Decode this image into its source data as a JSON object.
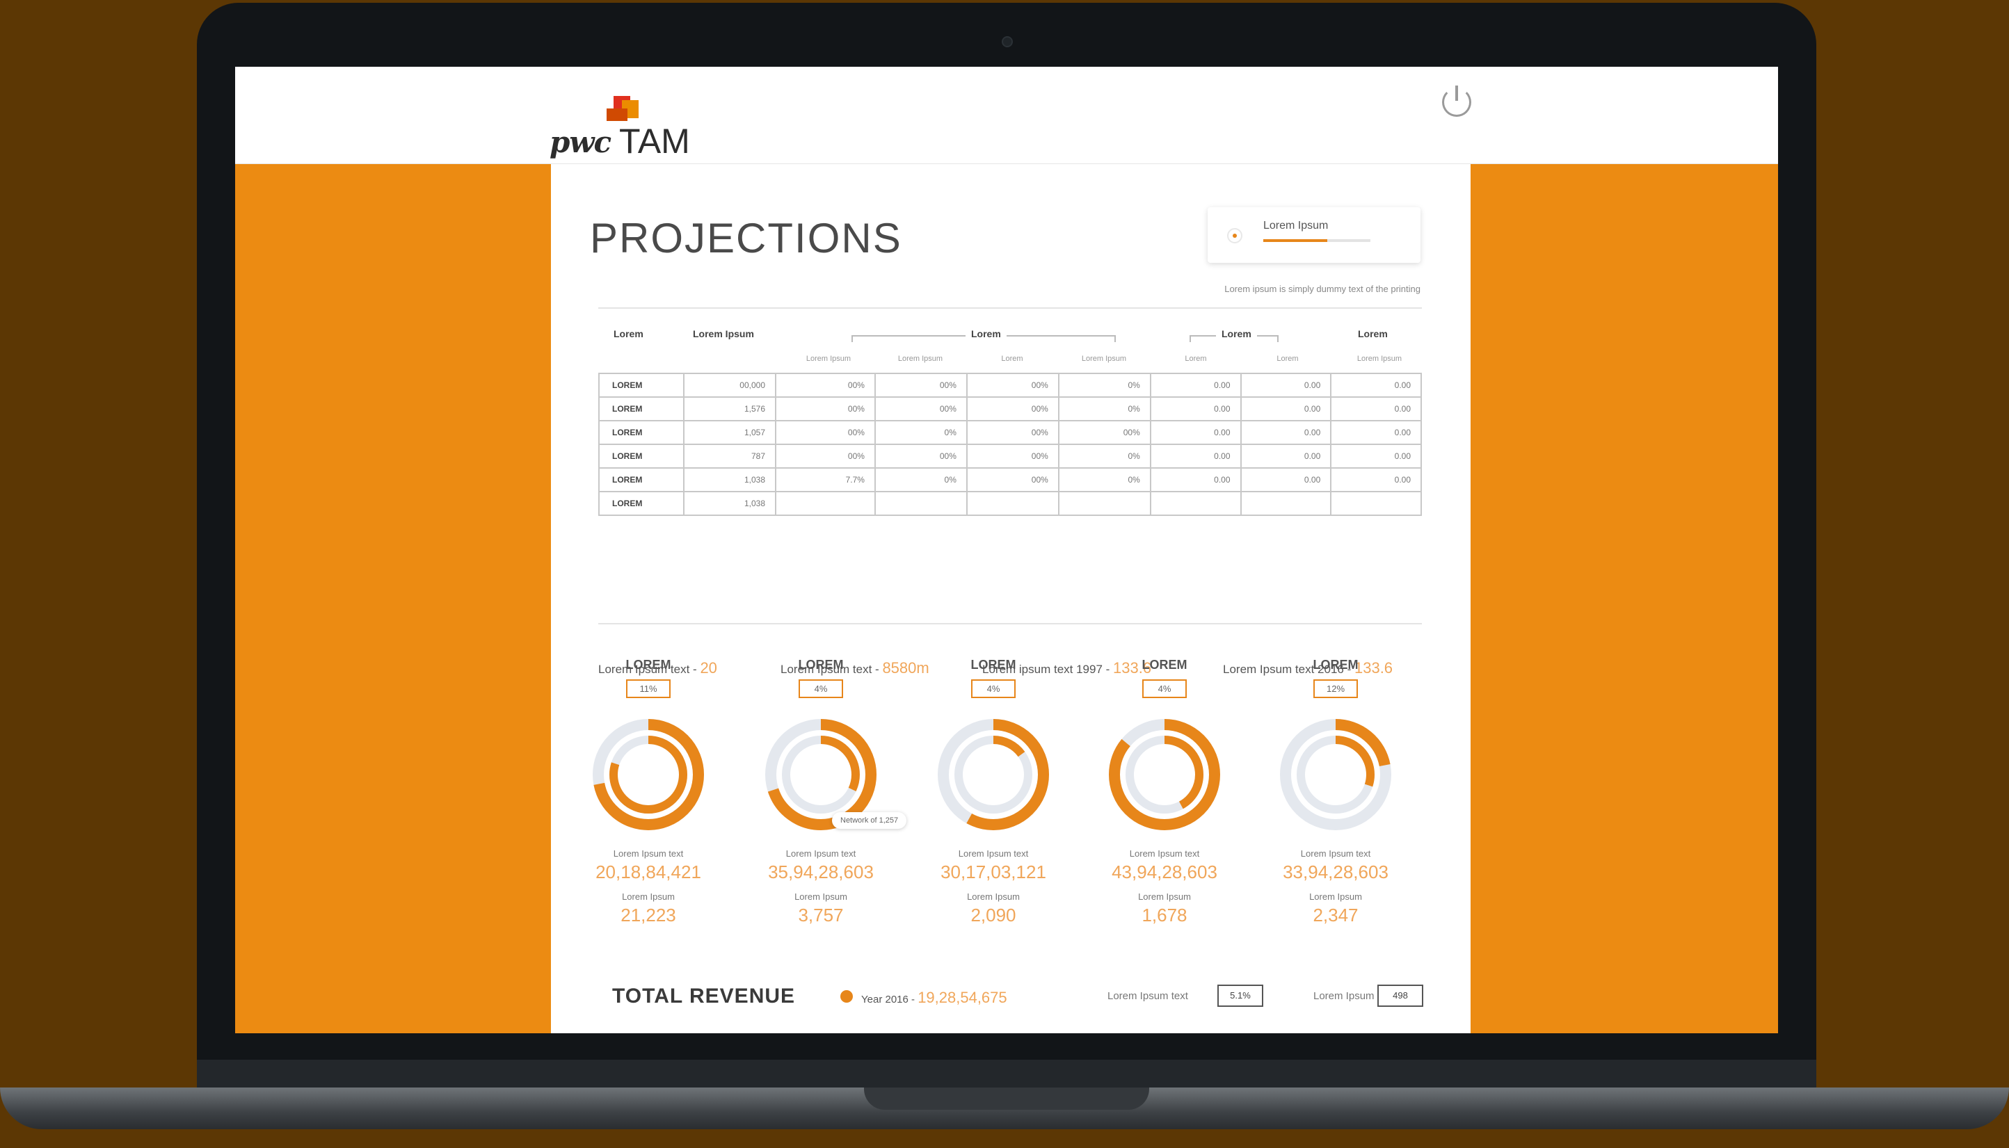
{
  "app": {
    "brand_pwc": "pwc",
    "brand_name": "TAM"
  },
  "colors": {
    "accent": "#e7861a",
    "accent_light": "#f0a65a",
    "side_bg": "#ec8b12",
    "ring_bg": "#e4e8ee"
  },
  "icons": {
    "logout": "power-icon"
  },
  "page": {
    "title": "PROJECTIONS",
    "note": "Lorem ipsum is simply dummy text of the printing"
  },
  "legend": {
    "label": "Lorem Ipsum",
    "progress": 0.6
  },
  "table": {
    "headers": {
      "c1": "Lorem",
      "c2": "Lorem Ipsum",
      "g1": "Lorem",
      "g2": "Lorem",
      "c9": "Lorem"
    },
    "subheaders": [
      "Lorem Ipsum",
      "Lorem Ipsum",
      "Lorem",
      "Lorem Ipsum",
      "Lorem",
      "Lorem",
      "Lorem Ipsum"
    ],
    "rows": [
      [
        "LOREM",
        "00,000",
        "00%",
        "00%",
        "00%",
        "0%",
        "0.00",
        "0.00",
        "0.00"
      ],
      [
        "LOREM",
        "1,576",
        "00%",
        "00%",
        "00%",
        "0%",
        "0.00",
        "0.00",
        "0.00"
      ],
      [
        "LOREM",
        "1,057",
        "00%",
        "0%",
        "00%",
        "00%",
        "0.00",
        "0.00",
        "0.00"
      ],
      [
        "LOREM",
        "787",
        "00%",
        "00%",
        "00%",
        "0%",
        "0.00",
        "0.00",
        "0.00"
      ],
      [
        "LOREM",
        "1,038",
        "7.7%",
        "0%",
        "00%",
        "0%",
        "0.00",
        "0.00",
        "0.00"
      ],
      [
        "LOREM",
        "1,038",
        "",
        "",
        "",
        "",
        "",
        "",
        ""
      ]
    ]
  },
  "stats": [
    {
      "label": "Lorem Ipsum text - ",
      "value": "20"
    },
    {
      "label": "Lorem Ipsum text - ",
      "value": "8580m"
    },
    {
      "label": "Lorem ipsum text 1997 - ",
      "value": "133.6"
    },
    {
      "label": "Lorem Ipsum text 2016 - ",
      "value": "133.6"
    }
  ],
  "donuts": [
    {
      "head": "LOREM",
      "badge": "11%",
      "inner": 0.8,
      "outer": 0.72,
      "l1": "Lorem Ipsum text",
      "v1": "20,18,84,421",
      "l2": "Lorem Ipsum",
      "v2": "21,223"
    },
    {
      "head": "LOREM",
      "badge": "4%",
      "inner": 0.32,
      "outer": 0.7,
      "l1": "Lorem Ipsum text",
      "v1": "35,94,28,603",
      "l2": "Lorem Ipsum",
      "v2": "3,757"
    },
    {
      "head": "LOREM",
      "badge": "4%",
      "inner": 0.15,
      "outer": 0.58,
      "l1": "Lorem Ipsum text",
      "v1": "30,17,03,121",
      "l2": "Lorem Ipsum",
      "v2": "2,090"
    },
    {
      "head": "LOREM",
      "badge": "4%",
      "inner": 0.42,
      "outer": 0.86,
      "l1": "Lorem Ipsum text",
      "v1": "43,94,28,603",
      "l2": "Lorem Ipsum",
      "v2": "1,678"
    },
    {
      "head": "LOREM",
      "badge": "12%",
      "inner": 0.3,
      "outer": 0.22,
      "l1": "Lorem Ipsum text",
      "v1": "33,94,28,603",
      "l2": "Lorem Ipsum",
      "v2": "2,347"
    }
  ],
  "tooltip": "Network of 1,257",
  "footer": {
    "title": "TOTAL REVENUE",
    "year_label": "Year 2016 - ",
    "year_value": "19,28,54,675",
    "label1": "Lorem Ipsum text",
    "box1": "5.1%",
    "label2": "Lorem Ipsum",
    "box2": "498"
  }
}
